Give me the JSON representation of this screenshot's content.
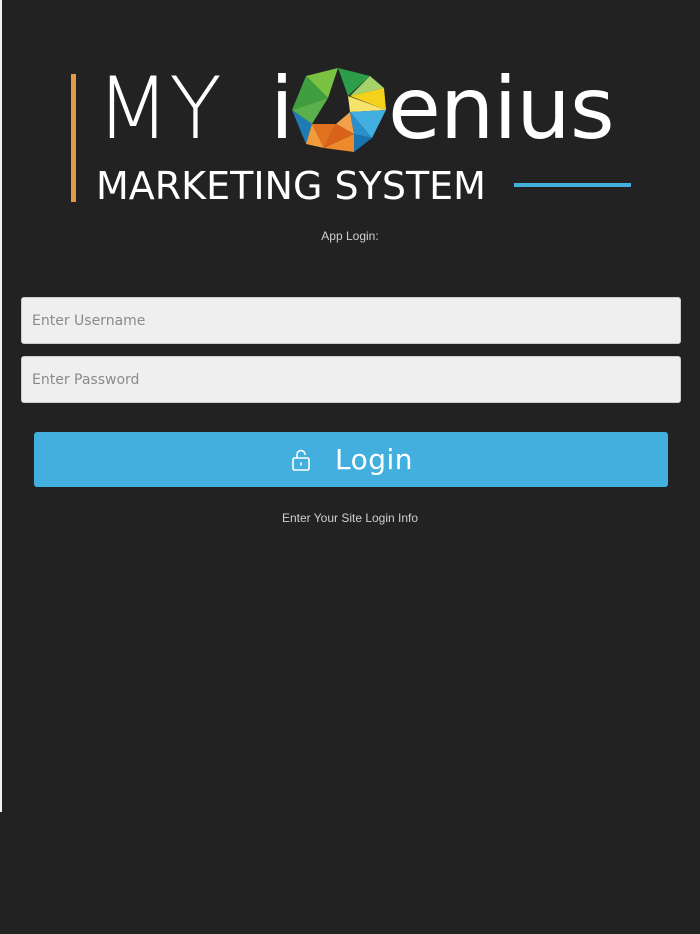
{
  "logo": {
    "word_my": "MY",
    "word_i": "i",
    "word_enius": "enius",
    "subtitle": "MARKETING SYSTEM",
    "accent_bar_color": "#e29a45",
    "accent_line_color": "#42afdf",
    "gem_icon": "multicolor-g-gem-icon"
  },
  "login": {
    "heading": "App Login:",
    "username_placeholder": "Enter Username",
    "password_placeholder": "Enter Password",
    "button_label": "Login",
    "button_icon": "unlock-icon",
    "hint": "Enter Your Site Login Info"
  },
  "colors": {
    "background": "#222222",
    "button": "#42afdf",
    "field_background": "#efefef"
  }
}
